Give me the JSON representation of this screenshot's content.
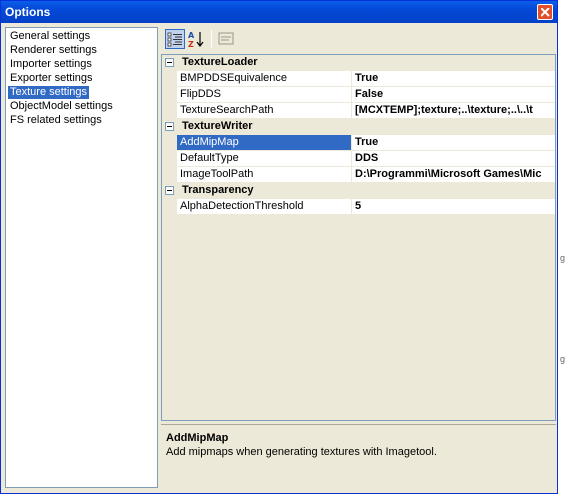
{
  "window": {
    "title": "Options"
  },
  "nav": {
    "items": [
      {
        "label": "General settings",
        "selected": false
      },
      {
        "label": "Renderer settings",
        "selected": false
      },
      {
        "label": "Importer settings",
        "selected": false
      },
      {
        "label": "Exporter settings",
        "selected": false
      },
      {
        "label": "Texture settings",
        "selected": true
      },
      {
        "label": "ObjectModel settings",
        "selected": false
      },
      {
        "label": "FS related settings",
        "selected": false
      }
    ]
  },
  "toolbar": {
    "categorized_icon": "categorized-icon",
    "alphabetical_icon": "alphabetical-sort-icon",
    "property_pages_icon": "property-pages-icon"
  },
  "grid": {
    "categories": [
      {
        "name": "TextureLoader",
        "props": [
          {
            "name": "BMPDDSEquivalence",
            "value": "True"
          },
          {
            "name": "FlipDDS",
            "value": "False"
          },
          {
            "name": "TextureSearchPath",
            "value": "[MCXTEMP];texture;..\\texture;..\\..\\t"
          }
        ]
      },
      {
        "name": "TextureWriter",
        "props": [
          {
            "name": "AddMipMap",
            "value": "True",
            "selected": true
          },
          {
            "name": "DefaultType",
            "value": "DDS"
          },
          {
            "name": "ImageToolPath",
            "value": "D:\\Programmi\\Microsoft Games\\Mic"
          }
        ]
      },
      {
        "name": "Transparency",
        "props": [
          {
            "name": "AlphaDetectionThreshold",
            "value": "5"
          }
        ]
      }
    ]
  },
  "description": {
    "title": "AddMipMap",
    "text": "Add mipmaps when generating textures with Imagetool."
  },
  "background": {
    "glyph": "g"
  },
  "colors": {
    "selection": "#316ac5",
    "titlebar": "#0448d6",
    "close": "#e2502b"
  }
}
